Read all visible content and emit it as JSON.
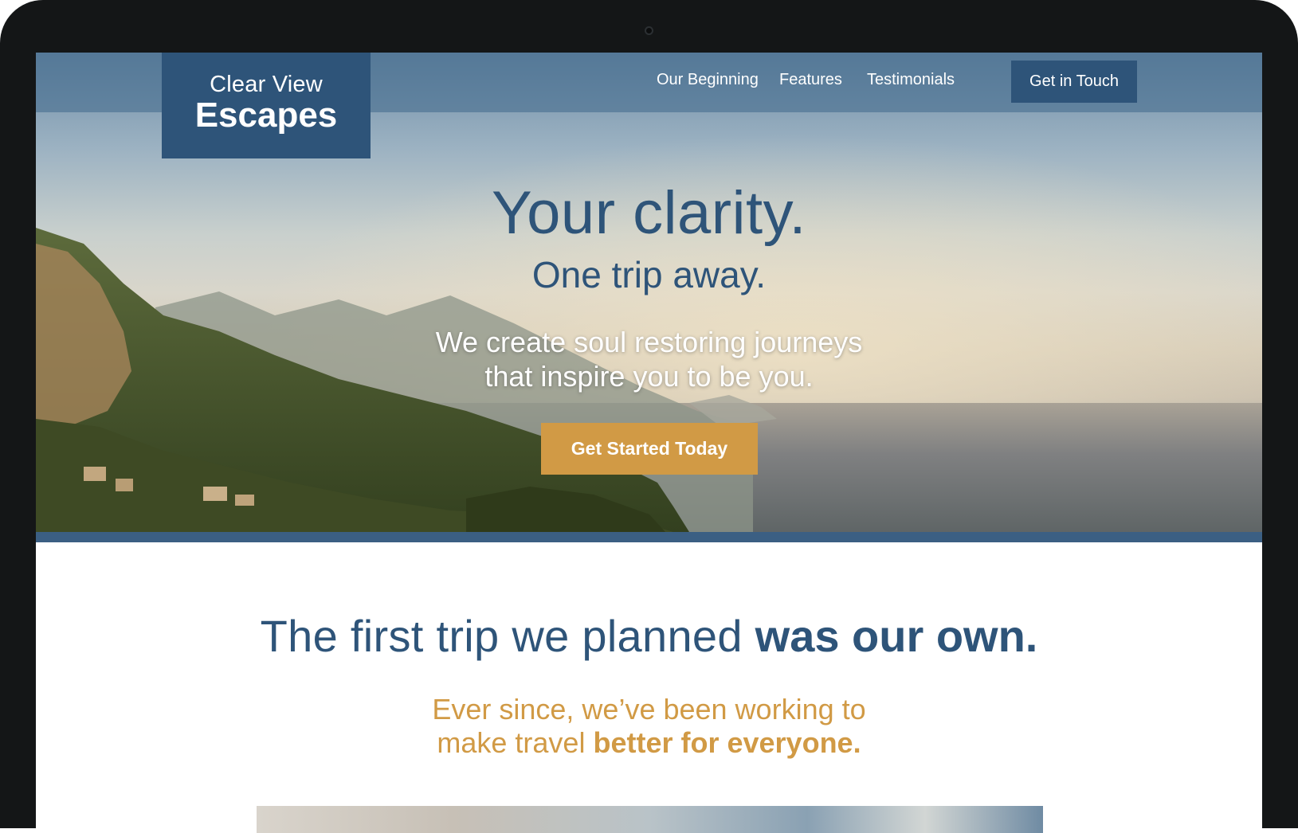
{
  "brand": {
    "line1": "Clear View",
    "line2": "Escapes"
  },
  "nav": {
    "links": [
      "Our Beginning",
      "Features",
      "Testimonials"
    ],
    "cta": "Get in Touch"
  },
  "hero": {
    "title": "Your clarity.",
    "subtitle": "One trip away.",
    "text_line1": "We create soul restoring journeys",
    "text_line2": "that inspire you to be you.",
    "button": "Get Started Today"
  },
  "about": {
    "heading_light": "The first trip we planned ",
    "heading_bold": "was our own.",
    "sub_line1": "Ever since, we’ve been working to",
    "sub_line2_light": "make travel ",
    "sub_line2_bold": "better for everyone."
  },
  "colors": {
    "primary": "#2e5479",
    "accent": "#d19a45",
    "bezel": "#141617"
  }
}
